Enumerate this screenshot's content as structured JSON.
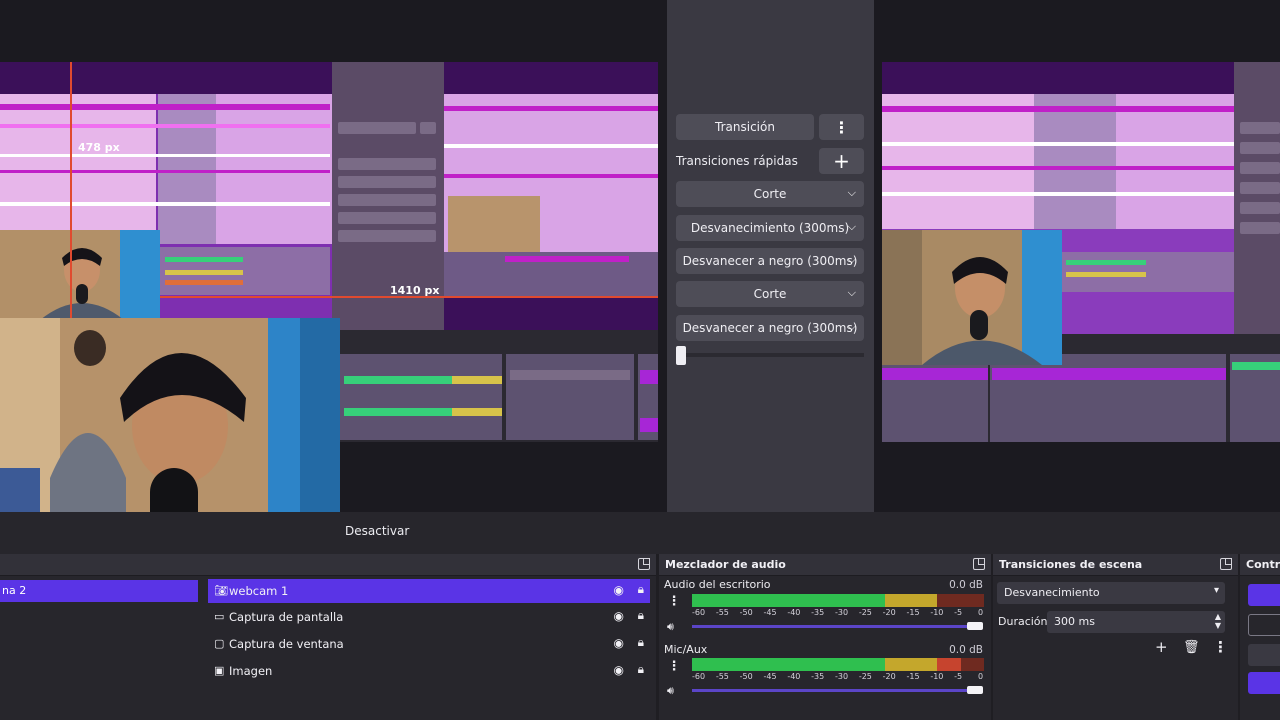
{
  "preview": {
    "guide_vertical_value": "478 px",
    "guide_horizontal_value": "1410 px"
  },
  "transition_panel": {
    "transition_button": "Transición",
    "quick_transitions_label": "Transiciones rápidas",
    "quick_list": [
      "Corte",
      "Desvanecimiento (300ms)",
      "Desvanecer a negro (300ms)",
      "Corte",
      "Desvanecer a negro (300ms)"
    ]
  },
  "toolbar": {
    "deactivate_label": "Desactivar"
  },
  "scenes": {
    "items": [
      {
        "label": "na 2",
        "active": true
      }
    ]
  },
  "sources": {
    "items": [
      {
        "label": "webcam 1",
        "icon": "camera-icon",
        "active": true
      },
      {
        "label": "Captura de pantalla",
        "icon": "monitor-icon",
        "active": false
      },
      {
        "label": "Captura de ventana",
        "icon": "window-icon",
        "active": false
      },
      {
        "label": "Imagen",
        "icon": "image-icon",
        "active": false
      }
    ]
  },
  "mixer": {
    "title": "Mezclador de audio",
    "channels": [
      {
        "name": "Audio del escritorio",
        "db": "0.0 dB",
        "level": 0.84
      },
      {
        "name": "Mic/Aux",
        "db": "0.0 dB",
        "level": 0.92
      }
    ],
    "ticks": [
      "-60",
      "-55",
      "-50",
      "-45",
      "-40",
      "-35",
      "-30",
      "-25",
      "-20",
      "-15",
      "-10",
      "-5",
      "0"
    ]
  },
  "scene_transitions": {
    "title": "Transiciones de escena",
    "selected": "Desvanecimiento",
    "duration_label": "Duración",
    "duration_value": "300 ms"
  },
  "controls": {
    "title": "Contro"
  },
  "colors": {
    "accent": "#5a34e6",
    "meter_green": "#2fbf4f",
    "meter_yellow": "#c4a72c",
    "meter_red": "#c6442e",
    "guide_red": "#e04a2f"
  }
}
